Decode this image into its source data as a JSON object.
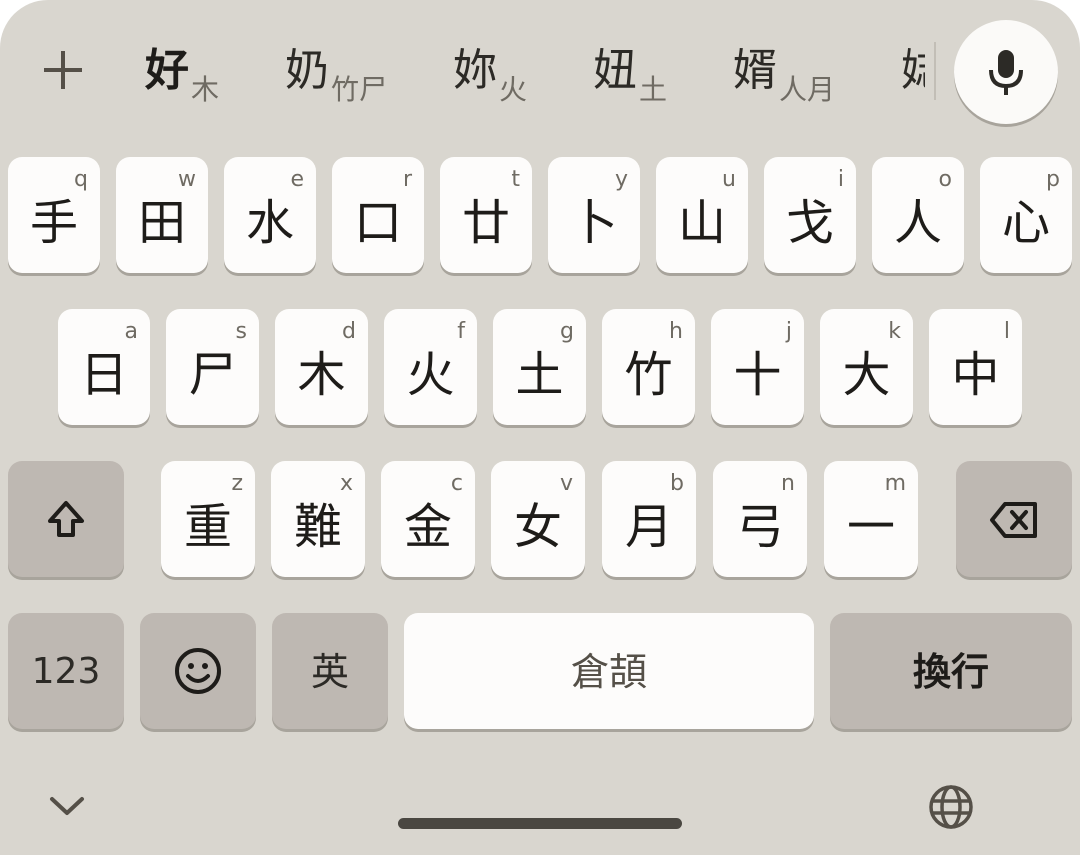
{
  "suggestions": {
    "add_icon": "plus-icon",
    "candidates": [
      {
        "char": "好",
        "code": "木"
      },
      {
        "char": "奶",
        "code": "竹尸"
      },
      {
        "char": "妳",
        "code": "火"
      },
      {
        "char": "妞",
        "code": "土"
      },
      {
        "char": "婿",
        "code": "人月"
      },
      {
        "char": "娡",
        "code": ""
      }
    ],
    "mic_icon": "microphone-icon"
  },
  "rows": {
    "row1": [
      {
        "char": "手",
        "hint": "q"
      },
      {
        "char": "田",
        "hint": "w"
      },
      {
        "char": "水",
        "hint": "e"
      },
      {
        "char": "口",
        "hint": "r"
      },
      {
        "char": "廿",
        "hint": "t"
      },
      {
        "char": "卜",
        "hint": "y"
      },
      {
        "char": "山",
        "hint": "u"
      },
      {
        "char": "戈",
        "hint": "i"
      },
      {
        "char": "人",
        "hint": "o"
      },
      {
        "char": "心",
        "hint": "p"
      }
    ],
    "row2": [
      {
        "char": "日",
        "hint": "a"
      },
      {
        "char": "尸",
        "hint": "s"
      },
      {
        "char": "木",
        "hint": "d"
      },
      {
        "char": "火",
        "hint": "f"
      },
      {
        "char": "土",
        "hint": "g"
      },
      {
        "char": "竹",
        "hint": "h"
      },
      {
        "char": "十",
        "hint": "j"
      },
      {
        "char": "大",
        "hint": "k"
      },
      {
        "char": "中",
        "hint": "l"
      }
    ],
    "row3": [
      {
        "char": "重",
        "hint": "z"
      },
      {
        "char": "難",
        "hint": "x"
      },
      {
        "char": "金",
        "hint": "c"
      },
      {
        "char": "女",
        "hint": "v"
      },
      {
        "char": "月",
        "hint": "b"
      },
      {
        "char": "弓",
        "hint": "n"
      },
      {
        "char": "一",
        "hint": "m"
      }
    ]
  },
  "bottom": {
    "numbers_label": "123",
    "emoji_icon": "smiley-icon",
    "language_label": "英",
    "space_label": "倉頡",
    "enter_label": "換行"
  },
  "icons": {
    "shift": "shift-arrow-icon",
    "backspace": "backspace-icon",
    "hide_keyboard": "chevron-down-icon",
    "switch_language": "globe-icon"
  },
  "colors": {
    "keyboard_bg": "#d9d6cf",
    "key_bg": "#fdfcfb",
    "function_key_bg": "#beb8b2"
  }
}
